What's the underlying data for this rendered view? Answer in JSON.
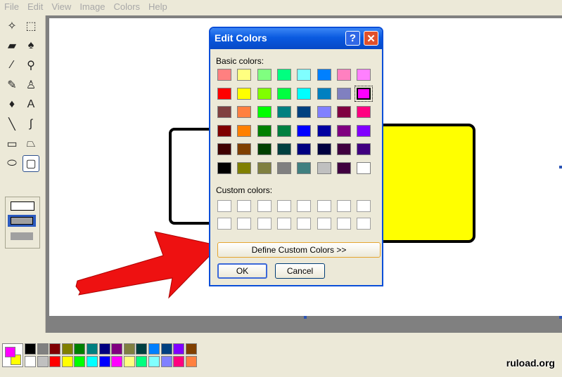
{
  "menu": [
    "File",
    "Edit",
    "View",
    "Image",
    "Colors",
    "Help"
  ],
  "tools": [
    {
      "name": "free-select-icon",
      "glyph": "✧"
    },
    {
      "name": "rect-select-icon",
      "glyph": "⬚"
    },
    {
      "name": "eraser-icon",
      "glyph": "▰"
    },
    {
      "name": "fill-bucket-icon",
      "glyph": "♠"
    },
    {
      "name": "color-picker-icon",
      "glyph": "⁄"
    },
    {
      "name": "magnifier-icon",
      "glyph": "⚲"
    },
    {
      "name": "pencil-icon",
      "glyph": "✎"
    },
    {
      "name": "brush-icon",
      "glyph": "♙"
    },
    {
      "name": "airbrush-icon",
      "glyph": "♦"
    },
    {
      "name": "text-icon",
      "glyph": "A"
    },
    {
      "name": "line-icon",
      "glyph": "╲"
    },
    {
      "name": "curve-icon",
      "glyph": "∫"
    },
    {
      "name": "rectangle-icon",
      "glyph": "▭"
    },
    {
      "name": "polygon-icon",
      "glyph": "⏢"
    },
    {
      "name": "ellipse-icon",
      "glyph": "⬭"
    },
    {
      "name": "rounded-rect-icon",
      "glyph": "▢"
    }
  ],
  "dialog": {
    "title": "Edit Colors",
    "help_glyph": "?",
    "close_glyph": "✕",
    "basic_label": "Basic colors:",
    "custom_label": "Custom colors:",
    "define_button": "Define Custom Colors >>",
    "ok_button": "OK",
    "cancel_button": "Cancel",
    "basic_colors": [
      [
        "#ff8080",
        "#ffff80",
        "#80ff80",
        "#00ff80",
        "#80ffff",
        "#0080ff",
        "#ff80c0",
        "#ff80ff"
      ],
      [
        "#ff0000",
        "#ffff00",
        "#80ff00",
        "#00ff40",
        "#00ffff",
        "#0080c0",
        "#8080c0",
        "#ff00ff"
      ],
      [
        "#804040",
        "#ff8040",
        "#00ff00",
        "#008080",
        "#004080",
        "#8080ff",
        "#800040",
        "#ff0080"
      ],
      [
        "#800000",
        "#ff8000",
        "#008000",
        "#008040",
        "#0000ff",
        "#0000a0",
        "#800080",
        "#8000ff"
      ],
      [
        "#400000",
        "#804000",
        "#004000",
        "#004040",
        "#000080",
        "#000040",
        "#400040",
        "#400080"
      ],
      [
        "#000000",
        "#808000",
        "#808040",
        "#808080",
        "#408080",
        "#c0c0c0",
        "#400040",
        "#ffffff"
      ]
    ],
    "selected_color": "#ff00ff",
    "custom_colors": [
      [
        "#ffffff",
        "#ffffff",
        "#ffffff",
        "#ffffff",
        "#ffffff",
        "#ffffff",
        "#ffffff",
        "#ffffff"
      ],
      [
        "#ffffff",
        "#ffffff",
        "#ffffff",
        "#ffffff",
        "#ffffff",
        "#ffffff",
        "#ffffff",
        "#ffffff"
      ]
    ]
  },
  "palette": {
    "foreground": "#ff00ff",
    "background": "#ffff00",
    "top": [
      "#000000",
      "#808080",
      "#800000",
      "#808000",
      "#008000",
      "#008080",
      "#000080",
      "#800080",
      "#808040",
      "#004040",
      "#0080ff",
      "#004080",
      "#8000ff",
      "#804000"
    ],
    "bottom": [
      "#ffffff",
      "#c0c0c0",
      "#ff0000",
      "#ffff00",
      "#00ff00",
      "#00ffff",
      "#0000ff",
      "#ff00ff",
      "#ffff80",
      "#00ff80",
      "#80ffff",
      "#8080ff",
      "#ff0080",
      "#ff8040"
    ]
  },
  "watermark": "ruload.org"
}
